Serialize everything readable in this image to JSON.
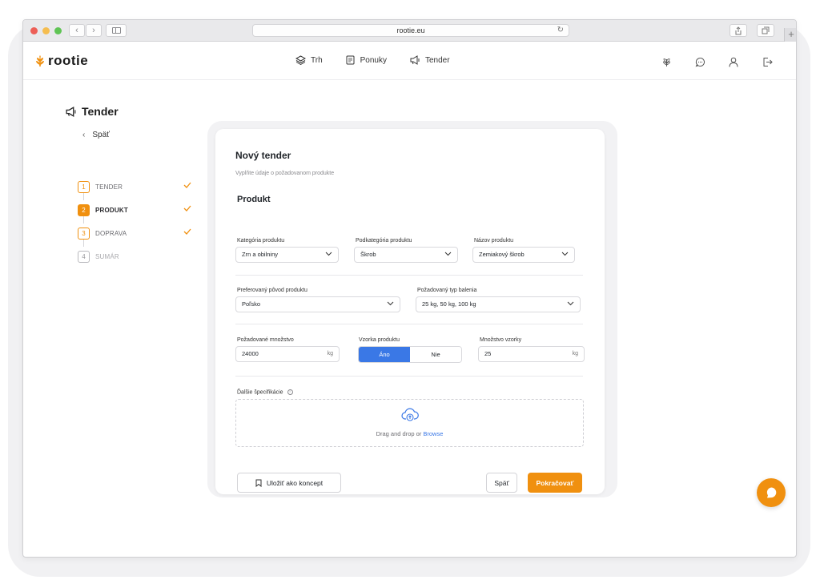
{
  "browser": {
    "url": "rootie.eu",
    "plus": "+"
  },
  "header": {
    "logo_text": "rootie",
    "nav": [
      {
        "label": "Trh",
        "icon": "layers-icon"
      },
      {
        "label": "Ponuky",
        "icon": "document-icon"
      },
      {
        "label": "Tender",
        "icon": "megaphone-icon"
      }
    ],
    "icons": [
      "wheat-icon",
      "chat-icon",
      "user-icon",
      "logout-icon"
    ]
  },
  "sidebar": {
    "title": "Tender",
    "back_label": "Späť",
    "steps": [
      {
        "num": "1",
        "label": "TENDER",
        "state": "done"
      },
      {
        "num": "2",
        "label": "PRODUKT",
        "state": "active"
      },
      {
        "num": "3",
        "label": "DOPRAVA",
        "state": "done"
      },
      {
        "num": "4",
        "label": "SUMÁR",
        "state": "pending"
      }
    ]
  },
  "form": {
    "title": "Nový tender",
    "subtitle": "Vyplňte údaje o požadovanom produkte",
    "section_title": "Produkt",
    "category": {
      "label": "Kategória produktu",
      "value": "Zrn a obilniny"
    },
    "subcategory": {
      "label": "Podkategória produktu",
      "value": "Škrob"
    },
    "product_name": {
      "label": "Názov produktu",
      "value": "Zemiakový škrob"
    },
    "origin": {
      "label": "Preferovaný pôvod produktu",
      "value": "Poľsko"
    },
    "packaging": {
      "label": "Požadovaný typ balenia",
      "value": "25 kg, 50 kg, 100 kg"
    },
    "quantity": {
      "label": "Požadované množstvo",
      "value": "24000",
      "unit": "kg"
    },
    "sample": {
      "label": "Vzorka produktu",
      "yes": "Áno",
      "no": "Nie",
      "selected": "yes"
    },
    "sample_qty": {
      "label": "Množstvo vzorky",
      "value": "25",
      "unit": "kg"
    },
    "specs": {
      "label": "Ďalšie špecifikácie",
      "info": "i"
    },
    "dropzone": {
      "text": "Drag and drop or ",
      "browse": "Browse"
    },
    "buttons": {
      "draft": "Uložiť ako koncept",
      "back": "Späť",
      "continue": "Pokračovať"
    }
  },
  "colors": {
    "accent": "#f0900f",
    "primary_blue": "#3a78e6"
  }
}
